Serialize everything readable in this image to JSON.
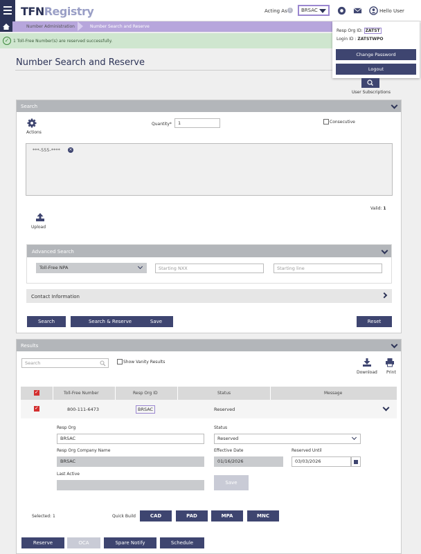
{
  "header": {
    "logo_part1": "TFN",
    "logo_part2": "Registry",
    "acting_as_label": "Acting As",
    "acting_as_value": "BRSAC",
    "hello_user": "Hello User"
  },
  "breadcrumb": {
    "items": [
      "Number Administration",
      "Number Search and Reserve"
    ]
  },
  "alert": {
    "message": "1 Toll-Free Number(s) are reserved successfully."
  },
  "user_menu": {
    "resp_org_label": "Resp Org ID:",
    "resp_org_value": "ZATST",
    "login_label": "Login ID :",
    "login_value": "ZATSTWPO",
    "change_password": "Change Password",
    "logout": "Logout"
  },
  "page": {
    "title": "Number Search and Reserve",
    "user_subscriptions": "User Subscriptions"
  },
  "search_panel": {
    "title": "Search",
    "actions_label": "Actions",
    "quantity_label": "Quantity*",
    "quantity_value": "1",
    "consecutive_label": "Consecutive",
    "token": "***-555-****",
    "valid_label": "Valid:",
    "valid_count": "1",
    "upload_label": "Upload",
    "advanced_search": "Advanced Search",
    "npa_select": "Toll-Free NPA",
    "nxx_placeholder": "Starting NXX",
    "line_placeholder": "Starting line",
    "contact_info": "Contact Information",
    "buttons": {
      "search": "Search",
      "search_reserve": "Search & Reserve",
      "save": "Save",
      "reset": "Reset"
    }
  },
  "results_panel": {
    "title": "Results",
    "search_placeholder": "Search",
    "show_vanity": "Show Vanity Results",
    "download": "Download",
    "print": "Print",
    "columns": [
      "Toll-Free Number",
      "Resp Org ID",
      "Status",
      "Message"
    ],
    "row": {
      "number": "800-111-6473",
      "resp_org": "BRSAC",
      "status": "Reserved",
      "message": ""
    },
    "detail": {
      "resp_org_label": "Resp Org",
      "resp_org_value": "BRSAC",
      "status_label": "Status",
      "status_value": "Reserved",
      "company_label": "Resp Org Company Name",
      "company_value": "BRSAC",
      "effective_label": "Effective Date",
      "effective_value": "01/16/2026",
      "reserved_until_label": "Reserved Until",
      "reserved_until_value": "03/03/2026",
      "last_active_label": "Last Active",
      "last_active_value": "",
      "save": "Save"
    },
    "selected_label": "Selected: 1",
    "quick_build_label": "Quick Build",
    "quick_build": [
      "CAD",
      "PAD",
      "MPA",
      "MNC"
    ]
  },
  "bottom_buttons": {
    "reserve": "Reserve",
    "oca": "OCA",
    "spare_notify": "Spare Notify",
    "schedule": "Schedule"
  }
}
